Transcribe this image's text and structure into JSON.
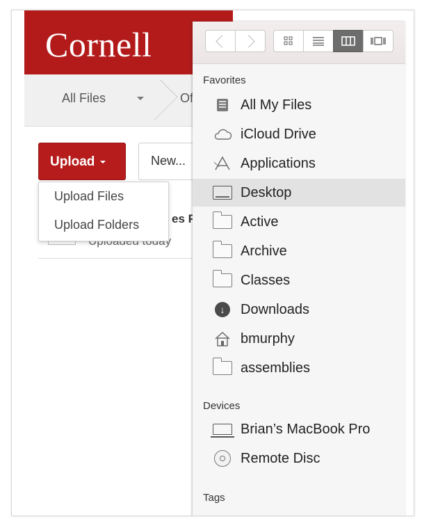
{
  "web": {
    "logo": "Cornell",
    "breadcrumb": {
      "root": "All Files",
      "current": "Offi"
    },
    "upload_button": "Upload",
    "new_button": "New...",
    "upload_menu": [
      "Upload Files",
      "Upload Folders"
    ],
    "file_row": {
      "title_fragment": "es F",
      "subtitle": "Uploaded today"
    }
  },
  "finder": {
    "view_icons": [
      "back-chevron-icon",
      "forward-chevron-icon",
      "icon-view-icon",
      "list-view-icon",
      "column-view-icon",
      "coverflow-view-icon"
    ],
    "sections": {
      "favorites": "Favorites",
      "devices": "Devices",
      "tags": "Tags"
    },
    "favorites": [
      {
        "label": "All My Files",
        "icon": "all-my-files-icon"
      },
      {
        "label": "iCloud Drive",
        "icon": "cloud-icon"
      },
      {
        "label": "Applications",
        "icon": "applications-icon"
      },
      {
        "label": "Desktop",
        "icon": "desktop-icon",
        "selected": true
      },
      {
        "label": "Active",
        "icon": "folder-icon"
      },
      {
        "label": "Archive",
        "icon": "folder-icon"
      },
      {
        "label": "Classes",
        "icon": "folder-icon"
      },
      {
        "label": "Downloads",
        "icon": "download-icon"
      },
      {
        "label": "bmurphy",
        "icon": "home-icon"
      },
      {
        "label": "assemblies",
        "icon": "folder-icon"
      }
    ],
    "devices": [
      {
        "label": "Brian’s MacBook Pro",
        "icon": "laptop-icon"
      },
      {
        "label": "Remote Disc",
        "icon": "disc-icon"
      }
    ]
  },
  "colors": {
    "cornell_red": "#b31b1b",
    "selection": "#e2e2e2"
  }
}
